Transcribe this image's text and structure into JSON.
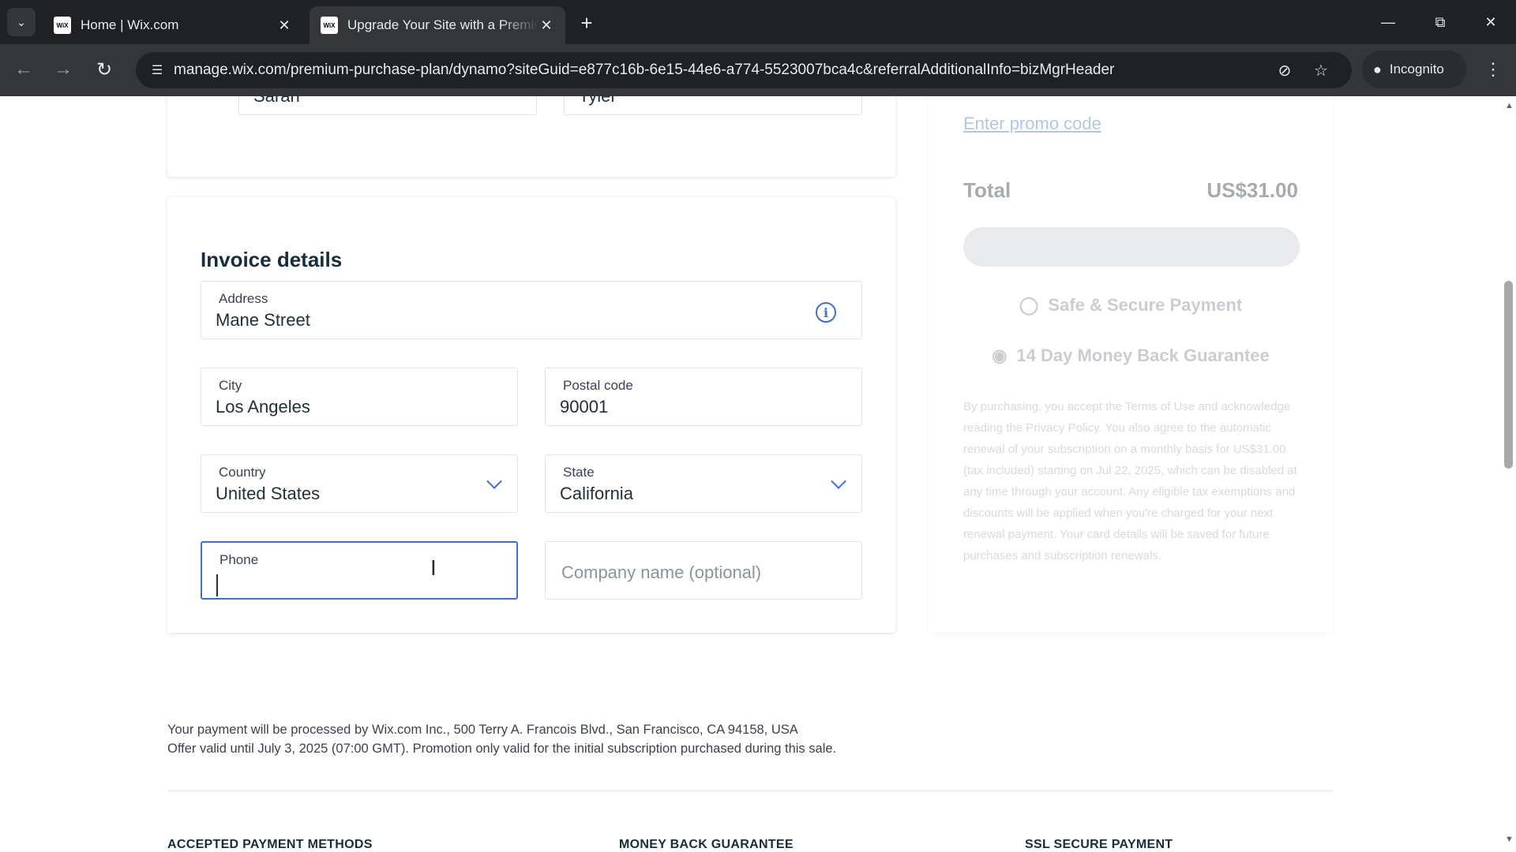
{
  "browser": {
    "tabs": [
      {
        "title": "Home | Wix.com",
        "favicon": "WiX",
        "active": false
      },
      {
        "title": "Upgrade Your Site with a Premium Plan",
        "favicon": "WiX",
        "active": true
      }
    ],
    "url": "manage.wix.com/premium-purchase-plan/dynamo?siteGuid=e877c16b-6e15-44e6-a774-5523007bca4c&referralAdditionalInfo=bizMgrHeader",
    "incognito_label": "Incognito",
    "icons": {
      "tab_list": "chevron-down-icon",
      "close": "close-icon",
      "new_tab": "plus-icon",
      "back": "back-arrow-icon",
      "forward": "forward-arrow-icon",
      "reload": "reload-icon",
      "site_info": "tune-icon",
      "eye_off": "eye-off-icon",
      "bookmark": "star-icon",
      "menu": "kebab-menu-icon"
    }
  },
  "names_card": {
    "first_name": "Sarah",
    "last_name": "Tyler"
  },
  "invoice": {
    "title": "Invoice details",
    "address": {
      "label": "Address",
      "value": "Mane Street"
    },
    "city": {
      "label": "City",
      "value": "Los Angeles"
    },
    "postal_code": {
      "label": "Postal code",
      "value": "90001"
    },
    "country": {
      "label": "Country",
      "value": "United States"
    },
    "state": {
      "label": "State",
      "value": "California"
    },
    "phone": {
      "label": "Phone",
      "value": ""
    },
    "company": {
      "placeholder": "Company name (optional)"
    }
  },
  "summary": {
    "promo_link": "Enter promo code",
    "total_label": "Total",
    "total_value": "US$31.00",
    "secure_payment": "Safe & Secure Payment",
    "money_back": "14 Day Money Back Guarantee",
    "legal": "By purchasing, you accept the Terms of Use and acknowledge reading the Privacy Policy. You also agree to the automatic renewal of your subscription on a monthly basis for US$31.00 (tax included) starting on Jul 22, 2025, which can be disabled at any time through your account. Any eligible tax exemptions and discounts will be applied when you're charged for your next renewal payment. Your card details will be saved for future purchases and subscription renewals."
  },
  "footer": {
    "processor_line": "Your payment will be processed by Wix.com Inc., 500 Terry A. Francois Blvd., San Francisco, CA 94158, USA",
    "offer_line": "Offer valid until July 3, 2025 (07:00 GMT). Promotion only valid for the initial subscription purchased during this sale.",
    "headings": [
      "ACCEPTED PAYMENT METHODS",
      "MONEY BACK GUARANTEE",
      "SSL SECURE PAYMENT"
    ]
  },
  "colors": {
    "accent": "#3b6fd6",
    "heading": "#162d3d",
    "chrome_dark": "#202124"
  }
}
